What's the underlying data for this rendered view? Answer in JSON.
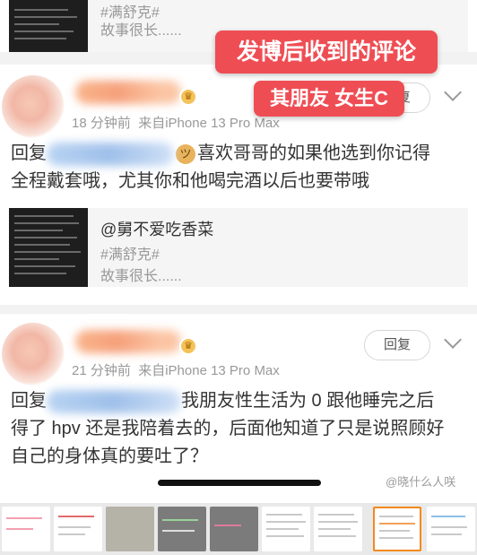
{
  "top_quote": {
    "tag": "#满舒克#",
    "desc": "故事很长......"
  },
  "callouts": {
    "main": "发博后收到的评论",
    "sub": "其朋友 女生C"
  },
  "comment1": {
    "time": "18 分钟前",
    "source": "来自iPhone 13 Pro Max",
    "reply_label": "回复",
    "line1_prefix": "回复",
    "line1_text": "喜欢哥哥的如果他选到你记得",
    "line2": "全程戴套哦，尤其你和他喝完酒以后也要带哦",
    "quote": {
      "author": "@舅不爱吃香菜",
      "tag": "#满舒克#",
      "desc": "故事很长......"
    }
  },
  "comment2": {
    "time": "21 分钟前",
    "source": "来自iPhone 13 Pro Max",
    "reply_button": "回复",
    "line1_prefix": "回复",
    "line1_text": "我朋友性生活为 0 跟他睡完之后",
    "line2": "得了 hpv 还是我陪着去的，后面他知道了只是说照顾好",
    "line3": "自己的身体真的要吐了？"
  },
  "watermark": "@晓什么人咲",
  "icons": {
    "crown": "crown-badge-icon",
    "doge": "doge-emoji-icon",
    "expand": "chevron-down-icon"
  },
  "colors": {
    "callout": "#ef4d54",
    "meta": "#999999",
    "selected_thumb": "#f2891d"
  }
}
